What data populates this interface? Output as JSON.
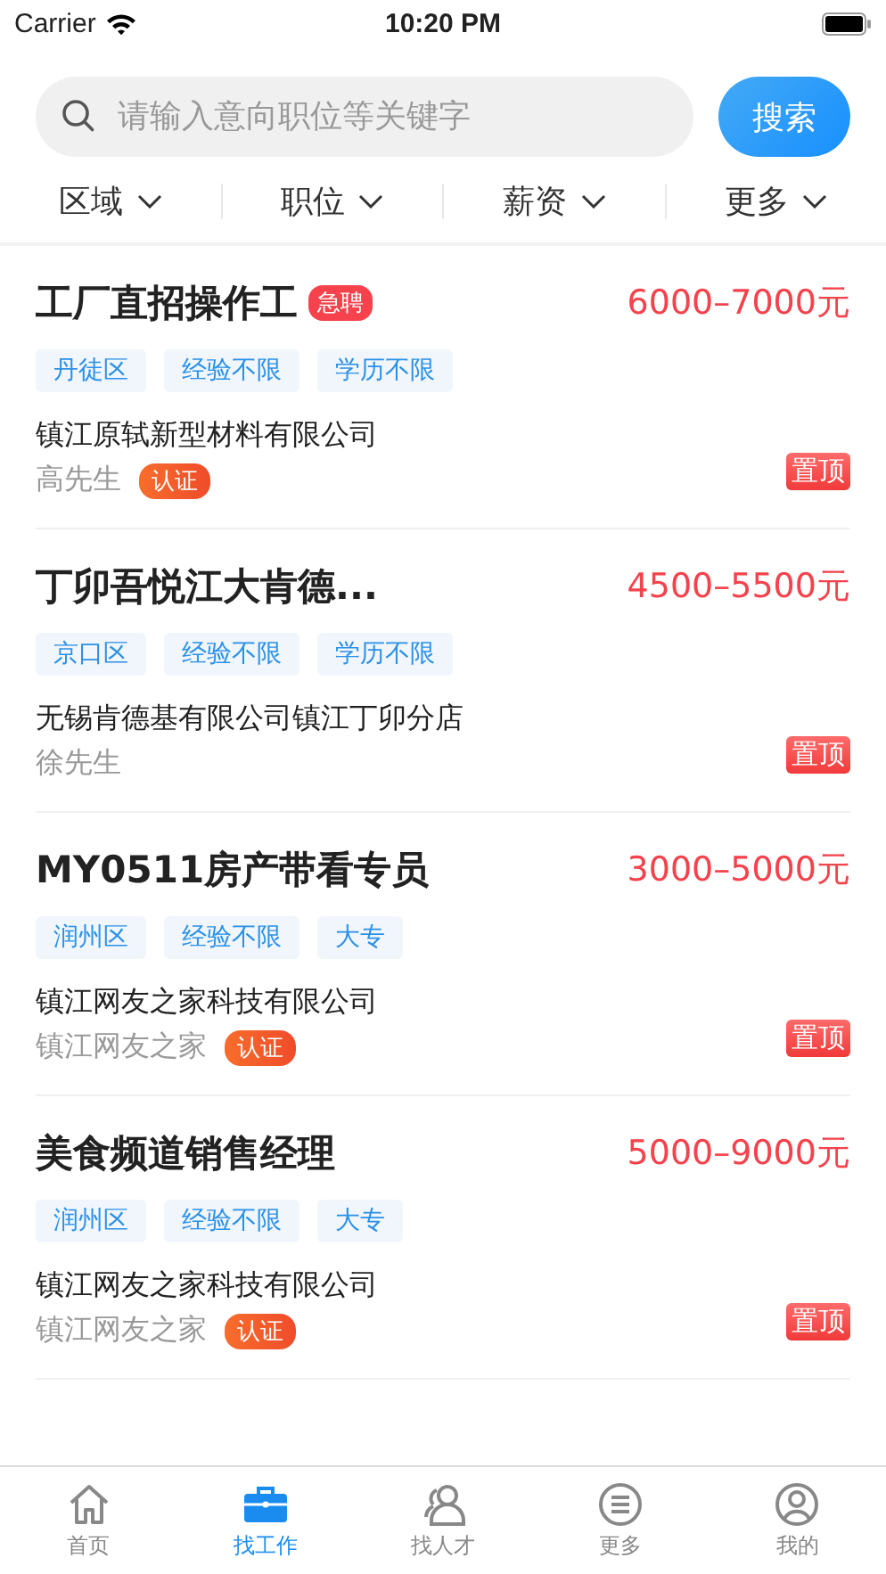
{
  "status_bar": {
    "carrier": "Carrier",
    "time": "10:20 PM"
  },
  "search": {
    "placeholder": "请输入意向职位等关键字",
    "button": "搜索"
  },
  "filters": [
    {
      "label": "区域"
    },
    {
      "label": "职位"
    },
    {
      "label": "薪资"
    },
    {
      "label": "更多"
    }
  ],
  "jobs": [
    {
      "title": "工厂直招操作工",
      "urgent": true,
      "urgent_label": "急聘",
      "salary": "6000–7000元",
      "tags": [
        "丹徒区",
        "经验不限",
        "学历不限"
      ],
      "company": "镇江原轼新型材料有限公司",
      "contact": "高先生",
      "verified": true,
      "verified_label": "认证",
      "pinned": true,
      "pinned_label": "置顶"
    },
    {
      "title": "丁卯吾悦江大肯德...",
      "urgent": false,
      "salary": "4500–5500元",
      "tags": [
        "京口区",
        "经验不限",
        "学历不限"
      ],
      "company": "无锡肯德基有限公司镇江丁卯分店",
      "contact": "徐先生",
      "verified": false,
      "pinned": true,
      "pinned_label": "置顶"
    },
    {
      "title": "MY0511房产带看专员",
      "urgent": false,
      "salary": "3000–5000元",
      "tags": [
        "润州区",
        "经验不限",
        "大专"
      ],
      "company": "镇江网友之家科技有限公司",
      "contact": "镇江网友之家",
      "verified": true,
      "verified_label": "认证",
      "pinned": true,
      "pinned_label": "置顶"
    },
    {
      "title": "美食频道销售经理",
      "urgent": false,
      "salary": "5000–9000元",
      "tags": [
        "润州区",
        "经验不限",
        "大专"
      ],
      "company": "镇江网友之家科技有限公司",
      "contact": "镇江网友之家",
      "verified": true,
      "verified_label": "认证",
      "pinned": true,
      "pinned_label": "置顶"
    }
  ],
  "tab_bar": [
    {
      "label": "首页",
      "kind": "home",
      "selected": false
    },
    {
      "label": "找工作",
      "kind": "briefcase",
      "selected": true
    },
    {
      "label": "找人才",
      "kind": "people",
      "selected": false
    },
    {
      "label": "更多",
      "kind": "menu",
      "selected": false
    },
    {
      "label": "我的",
      "kind": "user",
      "selected": false
    }
  ]
}
